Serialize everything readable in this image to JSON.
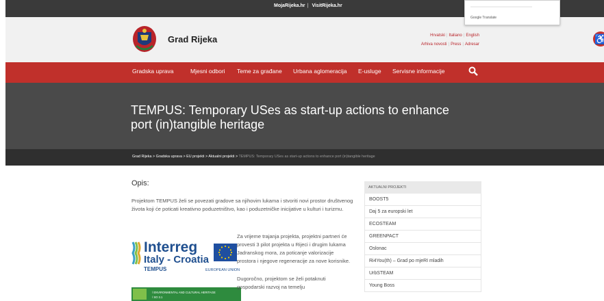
{
  "top_links": {
    "moja": "MojaRijeka.hr",
    "sep": "|",
    "visit": "VisitRijeka.hr"
  },
  "google_translate": {
    "label": "Google Translate"
  },
  "header": {
    "title": "Grad Rijeka",
    "lang": {
      "hr": "Hrvatski",
      "it": "Italiano",
      "en": "English"
    },
    "util": {
      "archive": "Arhiva novosti",
      "press": "Press",
      "adresar": "Adresar"
    },
    "sep": "|"
  },
  "nav": {
    "items": [
      "Gradska uprava",
      "Mjesni odbori",
      "Teme za građane",
      "Urbana aglomeracija",
      "E-usluge",
      "Servisne informacije"
    ]
  },
  "hero": {
    "title": "TEMPUS: Temporary USes as start-up actions to enhance port (in)tangible heritage"
  },
  "breadcrumb": {
    "items": [
      "Grad Rijeka",
      "Gradska uprava",
      "EU projekti",
      "Aktualni projekti"
    ],
    "current": "TEMPUS: Temporary USes as start-up actions to enhance port (in)tangible heritage",
    "sep": ">"
  },
  "main": {
    "heading": "Opis:",
    "p1": "Projektom TEMPUS želi se povezati gradove sa njihovim lukama i stvoriti novi prostor društvenog života koji će poticati kreativno poduzetništvo, kao i poduzetničke inicijative u kulturi i turizmu.",
    "p2": "Za vrijeme trajanja projekta, projektni partneri će provesti 3 pilot projekta u Rijeci i drugim lukama Jadranskog mora, za poticanje valorizacije prostora i njegove regeneracije za nove korisnike.",
    "p3": "Dugoročno, projektom se želi potaknuti gospodarski razvoj na temelju"
  },
  "logo_image": {
    "interreg": "Interreg",
    "region": "Italy - Croatia",
    "project": "TEMPUS",
    "eu": "EUROPEAN UNION",
    "strip": "/ ENVIRONMENTAL AND CULTURAL HERITAGE",
    "strip2": "/ SO 3.1"
  },
  "sidebar": {
    "heading": "AKTUALNI PROJEKTI",
    "items": [
      "BOOST5",
      "Daj 5 za europski let",
      "ECOSTEAM",
      "GREENPACT",
      "Oslonac",
      "Ri4You(th) – Grad po mjeRI mladih",
      "UrbSTEAM",
      "Young Boss"
    ]
  },
  "colors": {
    "brand_red": "#c0302b",
    "hero_bg": "#4a4a4a",
    "topbar": "#3a3a3a"
  }
}
